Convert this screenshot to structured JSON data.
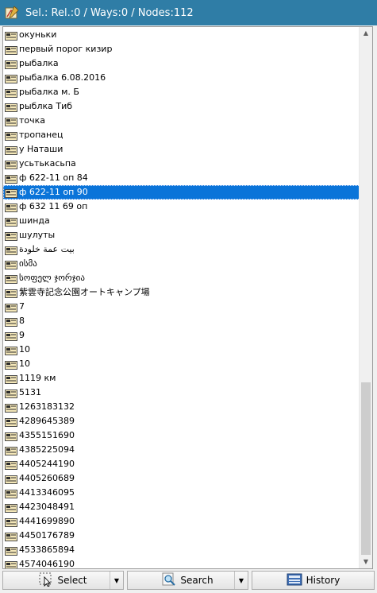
{
  "window": {
    "title": "Sel.: Rel.:0 / Ways:0 / Nodes:112"
  },
  "list": {
    "selected_index": 11,
    "items": [
      "окуньки",
      "первый порог кизир",
      "рыбалка",
      "рыбалка 6.08.2016",
      "рыбалка м. Б",
      "рыблка Тиб",
      "точка",
      "тропанец",
      "у Наташи",
      "усьтькасьпа",
      "ф 622-11 оп 84",
      "ф 622-11 оп 90",
      "ф 632 11 69 оп",
      "шинда",
      "шулуты",
      "بيت عمة خلودة",
      "ისმა",
      "სოფელ ჯორჯია",
      "紫雲寺記念公園オートキャンプ場",
      "7",
      "8",
      "9",
      "10",
      "10",
      "1119 км",
      "5131",
      "1263183132",
      "4289645389",
      "4355151690",
      "4385225094",
      "4405244190",
      "4405260689",
      "4413346095",
      "4423048491",
      "4441699890",
      "4450176789",
      "4533865894",
      "4574046190"
    ]
  },
  "toolbar": {
    "select_label": "Select",
    "search_label": "Search",
    "history_label": "History"
  },
  "icons": {
    "row": "node-icon",
    "select": "select-cursor-icon",
    "search": "search-icon",
    "history": "history-icon"
  },
  "colors": {
    "titlebar": "#2f7da6",
    "selection": "#0a74d9"
  }
}
